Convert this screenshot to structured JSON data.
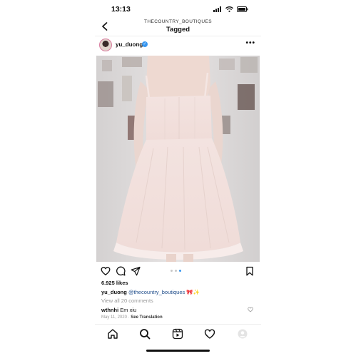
{
  "status_bar": {
    "time": "13:13"
  },
  "header": {
    "account": "THECOUNTRY_BOUTIQUES",
    "title": "Tagged"
  },
  "post": {
    "username": "yu_duong",
    "more": "•••",
    "likes": "6.925 likes",
    "caption_user": "yu_duong",
    "caption_mention": "@thecountry_boutiques",
    "caption_emoji": "🎀✨",
    "view_all": "View all 20 comments",
    "comment_user": "wthnhi",
    "comment_text": "Em xiu",
    "date": "May 11, 2020",
    "separator": "·",
    "see_translation": "See Translation",
    "carousel": {
      "count": 3,
      "active": 2
    }
  },
  "colors": {
    "accent": "#3897f0",
    "mention": "#1e4c8a",
    "muted": "#999999"
  }
}
